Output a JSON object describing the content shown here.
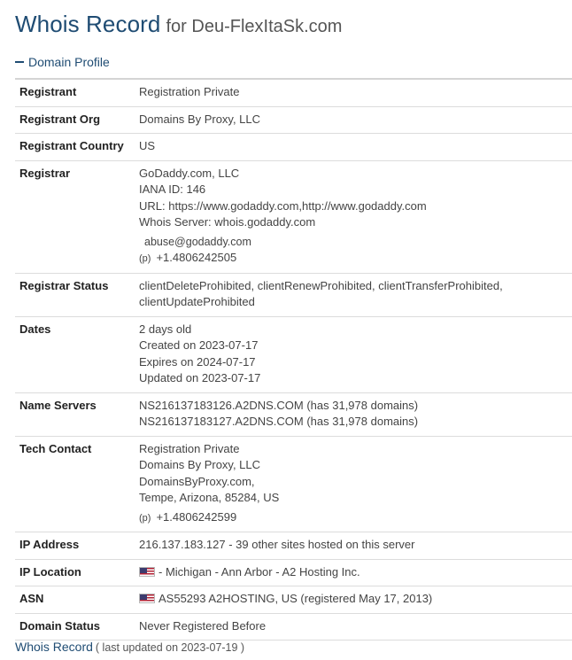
{
  "header": {
    "title": "Whois Record",
    "for_text": "for Deu-FlexItaSk.com"
  },
  "section": {
    "label": "Domain Profile"
  },
  "rows": {
    "registrant": {
      "label": "Registrant",
      "value": "Registration Private"
    },
    "registrant_org": {
      "label": "Registrant Org",
      "value": "Domains By Proxy, LLC"
    },
    "registrant_country": {
      "label": "Registrant Country",
      "value": "US"
    },
    "registrar": {
      "label": "Registrar",
      "name": "GoDaddy.com, LLC",
      "iana": "IANA ID: 146",
      "url": "URL: https://www.godaddy.com,http://www.godaddy.com",
      "whois_server": "Whois Server: whois.godaddy.com",
      "abuse_email": "abuse@godaddy.com",
      "phone_prefix": "(p)",
      "phone": "+1.4806242505"
    },
    "registrar_status": {
      "label": "Registrar Status",
      "value": "clientDeleteProhibited, clientRenewProhibited, clientTransferProhibited, clientUpdateProhibited"
    },
    "dates": {
      "label": "Dates",
      "age": "2 days old",
      "created": "Created on 2023-07-17",
      "expires": "Expires on 2024-07-17",
      "updated": "Updated on 2023-07-17"
    },
    "name_servers": {
      "label": "Name Servers",
      "ns1": "NS216137183126.A2DNS.COM (has 31,978 domains)",
      "ns2": "NS216137183127.A2DNS.COM (has 31,978 domains)"
    },
    "tech_contact": {
      "label": "Tech Contact",
      "name": "Registration Private",
      "org": "Domains By Proxy, LLC",
      "site": "DomainsByProxy.com,",
      "address": "Tempe, Arizona, 85284, US",
      "phone_prefix": "(p)",
      "phone": "+1.4806242599"
    },
    "ip_address": {
      "label": "IP Address",
      "value": "216.137.183.127 - 39 other sites hosted on this server"
    },
    "ip_location": {
      "label": "IP Location",
      "value": "- Michigan - Ann Arbor - A2 Hosting Inc.",
      "flag": "us-flag-icon"
    },
    "asn": {
      "label": "ASN",
      "value": "AS55293 A2HOSTING, US (registered May 17, 2013)",
      "flag": "us-flag-icon"
    },
    "domain_status": {
      "label": "Domain Status",
      "value": "Never Registered Before"
    }
  },
  "footer": {
    "title": "Whois Record",
    "updated": "( last updated on 2023-07-19 )"
  },
  "colors": {
    "heading_blue": "#1f4c73",
    "label_text": "#222222",
    "value_text": "#444444",
    "divider": "#dcdcdc"
  }
}
